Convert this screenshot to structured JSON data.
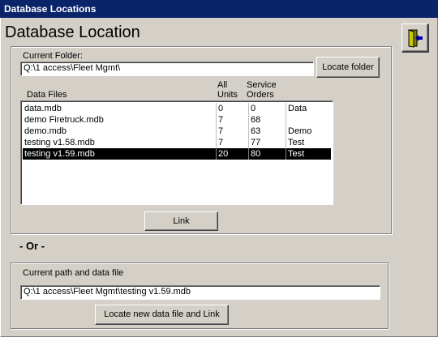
{
  "window": {
    "title": "Database Locations"
  },
  "heading": "Database Location",
  "exit_icon": "exit-door-icon",
  "folder": {
    "label": "Current Folder:",
    "value": "Q:\\1 access\\Fleet Mgmt\\",
    "locate_button": "Locate folder"
  },
  "list": {
    "headers": {
      "files": "Data Files",
      "all_units_1": "All",
      "all_units_2": "Units",
      "service_orders_1": "Service",
      "service_orders_2": "Orders"
    },
    "rows": [
      {
        "file": "data.mdb",
        "units": "0",
        "orders": "0",
        "type": "Data"
      },
      {
        "file": "demo Firetruck.mdb",
        "units": "7",
        "orders": "68",
        "type": ""
      },
      {
        "file": "demo.mdb",
        "units": "7",
        "orders": "63",
        "type": "Demo"
      },
      {
        "file": "testing v1.58.mdb",
        "units": "7",
        "orders": "77",
        "type": "Test"
      },
      {
        "file": "testing v1.59.mdb",
        "units": "20",
        "orders": "80",
        "type": "Test"
      }
    ],
    "selected_index": 4
  },
  "link_button": "Link",
  "or_label": "- Or -",
  "path": {
    "label": "Current path and data file",
    "value": "Q:\\1 access\\Fleet Mgmt\\testing v1.59.mdb",
    "locate_button": "Locate new data file and Link"
  }
}
